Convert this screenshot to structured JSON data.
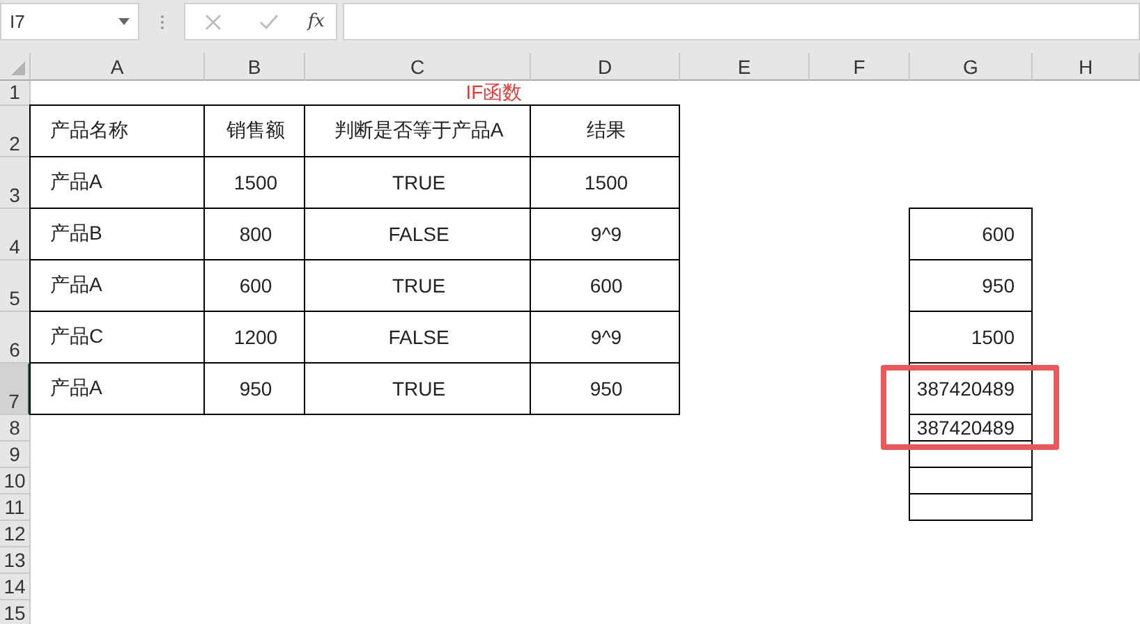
{
  "formula_bar": {
    "name_box": "I7",
    "function_button": "fx"
  },
  "columns": [
    {
      "label": "A",
      "selected": false
    },
    {
      "label": "B",
      "selected": false
    },
    {
      "label": "C",
      "selected": false
    },
    {
      "label": "D",
      "selected": false
    },
    {
      "label": "E",
      "selected": false
    },
    {
      "label": "F",
      "selected": false
    },
    {
      "label": "G",
      "selected": false
    },
    {
      "label": "H",
      "selected": false
    }
  ],
  "rows": [
    {
      "header": "1",
      "selected": false,
      "cells": [
        {
          "bordered": false
        },
        {
          "bordered": false
        },
        {
          "text": "IF函数",
          "kind": "title",
          "bordered": false
        }
      ]
    },
    {
      "header": "2",
      "selected": false,
      "cells": [
        {
          "text": "产品名称",
          "bordered": true
        },
        {
          "text": "销售额",
          "bordered": true
        },
        {
          "text": "判断是否等于产品A",
          "bordered": true
        },
        {
          "text": "结果",
          "bordered": true
        }
      ]
    },
    {
      "header": "3",
      "selected": false,
      "cells": [
        {
          "text": "产品A",
          "bordered": true
        },
        {
          "text": "1500",
          "bordered": true
        },
        {
          "text": "TRUE",
          "bordered": true
        },
        {
          "text": "1500",
          "bordered": true
        }
      ]
    },
    {
      "header": "4",
      "selected": false,
      "cells": [
        {
          "text": "产品B",
          "bordered": true
        },
        {
          "text": "800",
          "bordered": true
        },
        {
          "text": "FALSE",
          "bordered": true
        },
        {
          "text": "9^9",
          "bordered": true
        },
        {
          "bordered": false
        },
        {
          "bordered": false
        },
        {
          "text": "600",
          "bordered": true
        }
      ]
    },
    {
      "header": "5",
      "selected": false,
      "cells": [
        {
          "text": "产品A",
          "bordered": true
        },
        {
          "text": "600",
          "bordered": true
        },
        {
          "text": "TRUE",
          "bordered": true
        },
        {
          "text": "600",
          "bordered": true
        },
        {
          "bordered": false
        },
        {
          "bordered": false
        },
        {
          "text": "950",
          "bordered": true
        }
      ]
    },
    {
      "header": "6",
      "selected": false,
      "cells": [
        {
          "text": "产品C",
          "bordered": true
        },
        {
          "text": "1200",
          "bordered": true
        },
        {
          "text": "FALSE",
          "bordered": true
        },
        {
          "text": "9^9",
          "bordered": true
        },
        {
          "bordered": false
        },
        {
          "bordered": false
        },
        {
          "text": "1500",
          "bordered": true
        }
      ]
    },
    {
      "header": "7",
      "selected": true,
      "cells": [
        {
          "text": "产品A",
          "bordered": true
        },
        {
          "text": "950",
          "bordered": true
        },
        {
          "text": "TRUE",
          "bordered": true
        },
        {
          "text": "950",
          "bordered": true
        },
        {
          "bordered": false
        },
        {
          "bordered": false
        },
        {
          "text": "387420489",
          "bordered": true
        }
      ]
    },
    {
      "header": "8",
      "selected": false,
      "cells": [
        {
          "bordered": false
        },
        {
          "bordered": false
        },
        {
          "bordered": false
        },
        {
          "bordered": false
        },
        {
          "bordered": false
        },
        {
          "bordered": false
        },
        {
          "text": "387420489",
          "bordered": true
        }
      ]
    },
    {
      "header": "9",
      "selected": false,
      "cells": [
        {
          "bordered": false
        },
        {
          "bordered": false
        },
        {
          "bordered": false
        },
        {
          "bordered": false
        },
        {
          "bordered": false
        },
        {
          "bordered": false
        },
        {
          "bordered": true
        }
      ]
    },
    {
      "header": "10",
      "selected": false,
      "cells": [
        {
          "bordered": false
        },
        {
          "bordered": false
        },
        {
          "bordered": false
        },
        {
          "bordered": false
        },
        {
          "bordered": false
        },
        {
          "bordered": false
        },
        {
          "bordered": true
        }
      ]
    },
    {
      "header": "11",
      "selected": false,
      "cells": [
        {
          "bordered": false
        },
        {
          "bordered": false
        },
        {
          "bordered": false
        },
        {
          "bordered": false
        },
        {
          "bordered": false
        },
        {
          "bordered": false
        },
        {
          "bordered": true
        }
      ]
    },
    {
      "header": "12",
      "selected": false
    },
    {
      "header": "13",
      "selected": false
    },
    {
      "header": "14",
      "selected": false
    },
    {
      "header": "15",
      "selected": false
    }
  ]
}
